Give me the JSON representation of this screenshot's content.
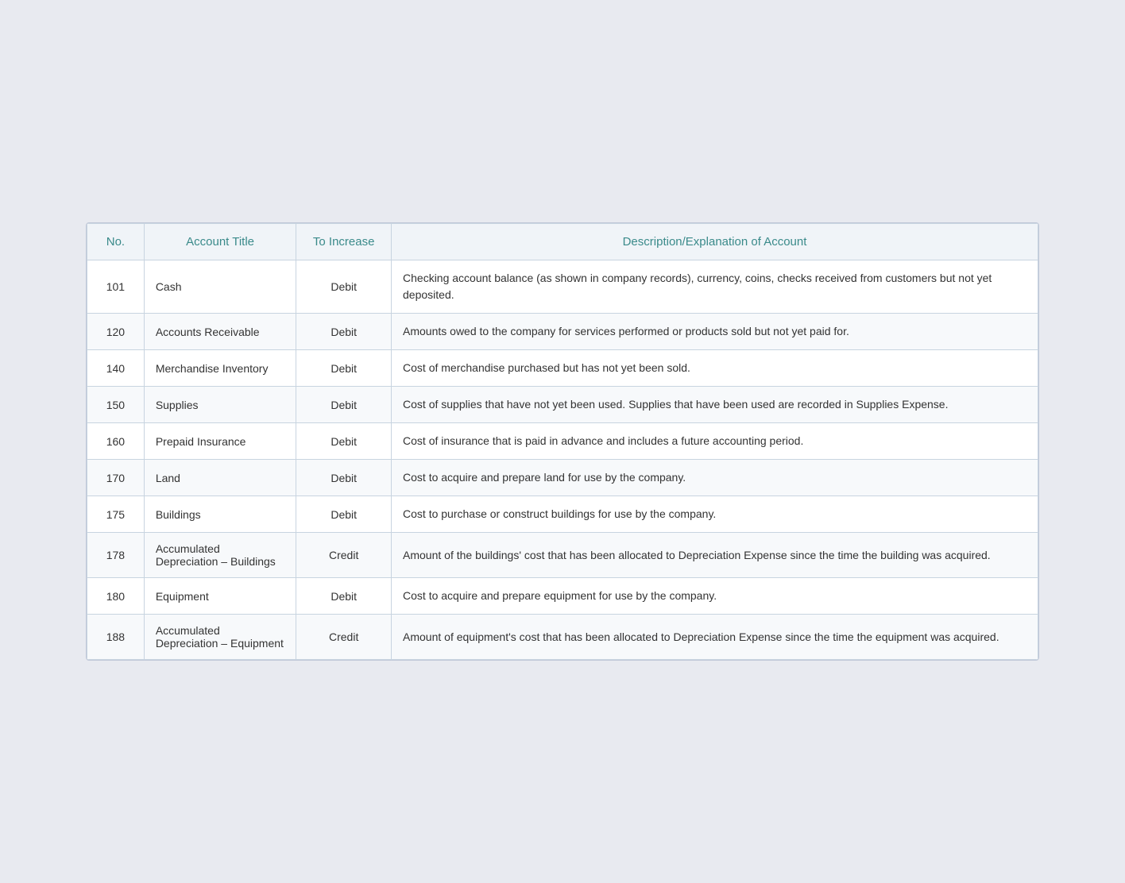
{
  "table": {
    "headers": {
      "no": "No.",
      "account_title": "Account Title",
      "to_increase": "To Increase",
      "description": "Description/Explanation of Account"
    },
    "rows": [
      {
        "no": "101",
        "title": "Cash",
        "increase": "Debit",
        "description": "Checking account balance (as shown in company records), currency, coins, checks received from customers but not yet deposited."
      },
      {
        "no": "120",
        "title": "Accounts Receivable",
        "increase": "Debit",
        "description": "Amounts owed to the company for services performed or products sold but not yet paid for."
      },
      {
        "no": "140",
        "title": "Merchandise Inventory",
        "increase": "Debit",
        "description": "Cost of merchandise purchased but has not yet been sold."
      },
      {
        "no": "150",
        "title": "Supplies",
        "increase": "Debit",
        "description": "Cost of supplies that have not yet been used. Supplies that have been used are recorded in Supplies Expense."
      },
      {
        "no": "160",
        "title": "Prepaid Insurance",
        "increase": "Debit",
        "description": "Cost of insurance that is paid in advance and includes a future accounting period."
      },
      {
        "no": "170",
        "title": "Land",
        "increase": "Debit",
        "description": "Cost to acquire and prepare land for use by the company."
      },
      {
        "no": "175",
        "title": "Buildings",
        "increase": "Debit",
        "description": "Cost to purchase or construct buildings for use by the company."
      },
      {
        "no": "178",
        "title": "Accumulated Depreciation – Buildings",
        "increase": "Credit",
        "description": "Amount of the buildings' cost that has been allocated to Depreciation Expense since the time the building was acquired."
      },
      {
        "no": "180",
        "title": "Equipment",
        "increase": "Debit",
        "description": "Cost to acquire and prepare equipment for use by the company."
      },
      {
        "no": "188",
        "title": "Accumulated Depreciation – Equipment",
        "increase": "Credit",
        "description": "Amount of equipment's cost that has been allocated to Depreciation Expense since the time the equipment was acquired."
      }
    ]
  }
}
